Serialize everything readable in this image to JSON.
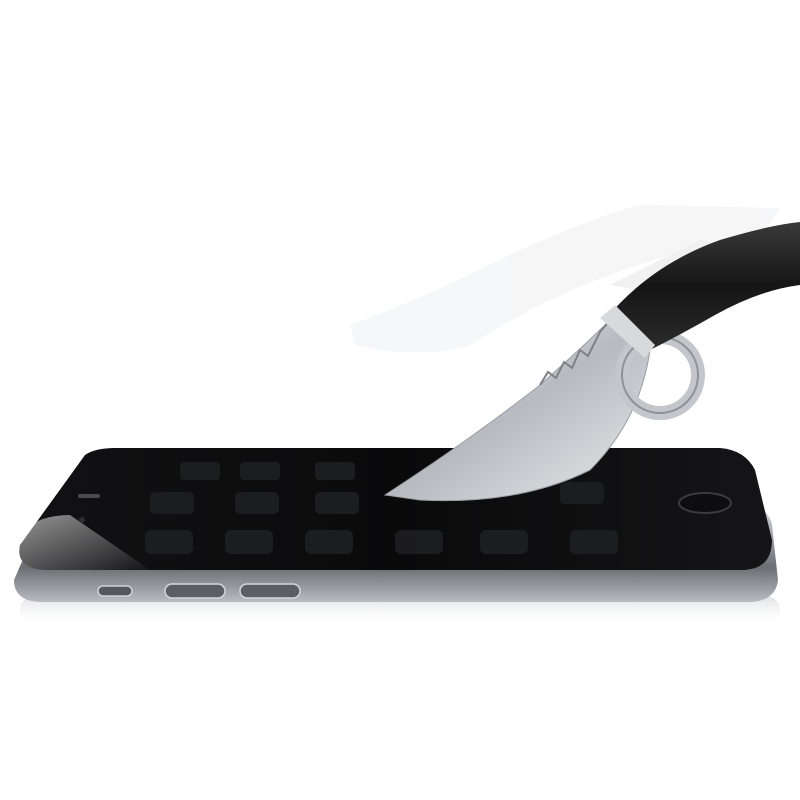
{
  "scene": {
    "subject": "phone-privacy-screen-protector-knife-test",
    "background_color": "#ffffff",
    "phone_body_color": "#7f8287",
    "screen_color": "#0b0b0d",
    "knife_handle_color": "#1a1a1a",
    "blade_color": "#cfd2d6",
    "icons": {
      "home_button": "home-button-icon",
      "speaker": "speaker-icon",
      "camera": "front-camera-icon",
      "mute_switch": "mute-switch-icon",
      "volume_up": "volume-up-icon",
      "volume_down": "volume-down-icon"
    }
  }
}
